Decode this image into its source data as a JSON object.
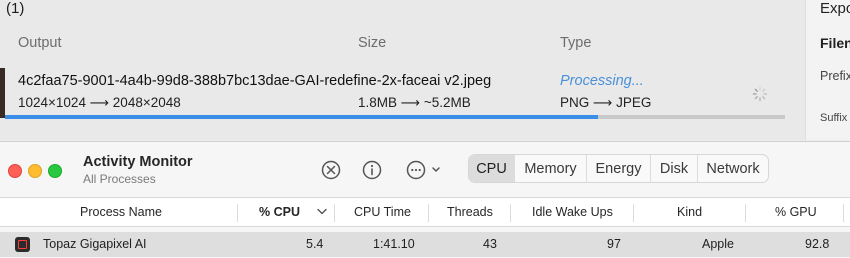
{
  "topaz": {
    "queue_count": "(1)",
    "headers": {
      "output": "Output",
      "size": "Size",
      "type": "Type"
    },
    "file": {
      "name": "4c2faa75-9001-4a4b-99d8-388b7bc13dae-GAI-redefine-2x-faceai v2.jpeg",
      "dimensions": "1024×1024 ⟶ 2048×2048",
      "size_change": "1.8MB ⟶ ~5.2MB",
      "status": "Processing...",
      "type_change": "PNG ⟶ JPEG",
      "progress_fraction": 0.76
    },
    "side_panel": {
      "title": "Expo",
      "filename_label": "Filen",
      "prefix_label": "Prefix",
      "suffix_label": "Suffix"
    },
    "colors": {
      "progress": "#3a8ee8",
      "processing": "#4a90d9"
    }
  },
  "activity_monitor": {
    "title": "Activity Monitor",
    "subtitle": "All Processes",
    "toolbar_icons": [
      "stop-process-icon",
      "info-icon",
      "more-actions-icon"
    ],
    "tabs": [
      "CPU",
      "Memory",
      "Energy",
      "Disk",
      "Network"
    ],
    "active_tab": "CPU",
    "columns": [
      "Process Name",
      "% CPU",
      "CPU Time",
      "Threads",
      "Idle Wake Ups",
      "Kind",
      "% GPU"
    ],
    "sorted_column": "% CPU",
    "rows": [
      {
        "name": "Topaz Gigapixel AI",
        "cpu": "5.4",
        "cpu_time": "1:41.10",
        "threads": "43",
        "idle_wake_ups": "97",
        "kind": "Apple",
        "gpu": "92.8"
      }
    ]
  }
}
